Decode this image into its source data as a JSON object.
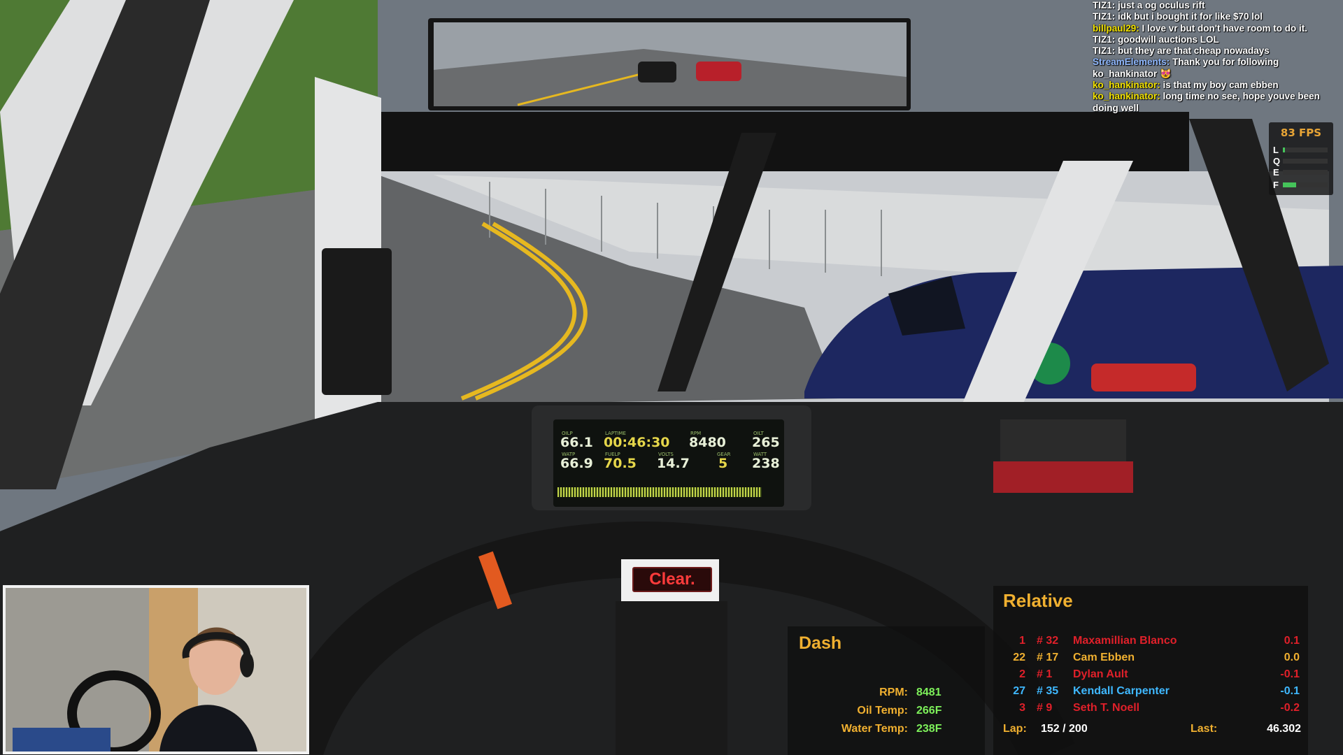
{
  "chat": [
    {
      "user": "TIZ1:",
      "color": "#ffffff",
      "text": "just a og oculus rift"
    },
    {
      "user": "TIZ1:",
      "color": "#ffffff",
      "text": "idk but i bought it for like $70 lol"
    },
    {
      "user": "billpaul29:",
      "color": "#f2e200",
      "text": "I love vr but don't have room to do it."
    },
    {
      "user": "TIZ1:",
      "color": "#ffffff",
      "text": "goodwill auctions LOL"
    },
    {
      "user": "TIZ1:",
      "color": "#ffffff",
      "text": "but they are that cheap nowadays"
    },
    {
      "user": "StreamElements:",
      "color": "#8fb8ff",
      "text": "Thank you for following ko_hankinator 😻"
    },
    {
      "user": "ko_hankinator:",
      "color": "#f2e200",
      "text": "is that my boy cam ebben"
    },
    {
      "user": "ko_hankinator:",
      "color": "#f2e200",
      "text": "long time no see, hope youve been doing well"
    }
  ],
  "fps": {
    "value": "83 FPS",
    "bars": [
      {
        "label": "L",
        "level": 0.05
      },
      {
        "label": "Q",
        "level": 0.0
      },
      {
        "label": "E",
        "level": 0.0
      },
      {
        "label": "F",
        "level": 0.3
      }
    ]
  },
  "lcd": {
    "oilp_label": "OILP",
    "oilp": "66.1",
    "laptime_label": "LAPTIME",
    "laptime": "00:46:30",
    "rpm_label": "RPM",
    "rpm": "8480",
    "oilt_label": "OILT",
    "oilt": "265",
    "watp_label": "WATP",
    "watp": "66.9",
    "fuelp_label": "FUELP",
    "fuelp": "70.5",
    "volts_label": "VOLTS",
    "volts": "14.7",
    "gear_label": "GEAR",
    "gear": "5",
    "watt_label": "WATT",
    "watt": "238"
  },
  "spotter": "Clear.",
  "dash": {
    "title": "Dash",
    "rows": [
      {
        "label": "RPM:",
        "value": "8481"
      },
      {
        "label": "Oil Temp:",
        "value": "266F"
      },
      {
        "label": "Water Temp:",
        "value": "238F"
      }
    ]
  },
  "relative": {
    "title": "Relative",
    "rows": [
      {
        "pos": "1",
        "num": "# 32",
        "name": "Maxamillian Blanco",
        "gap": "0.1",
        "color": "#e0202a"
      },
      {
        "pos": "22",
        "num": "# 17",
        "name": "Cam Ebben",
        "gap": "0.0",
        "color": "#f0b030"
      },
      {
        "pos": "2",
        "num": "# 1",
        "name": "Dylan Ault",
        "gap": "-0.1",
        "color": "#e0202a"
      },
      {
        "pos": "27",
        "num": "# 35",
        "name": "Kendall Carpenter",
        "gap": "-0.1",
        "color": "#3fb8ff"
      },
      {
        "pos": "3",
        "num": "# 9",
        "name": "Seth T. Noell",
        "gap": "-0.2",
        "color": "#e0202a"
      }
    ],
    "lap_label": "Lap:",
    "lap_value": "152 / 200",
    "last_label": "Last:",
    "last_value": "46.302"
  }
}
